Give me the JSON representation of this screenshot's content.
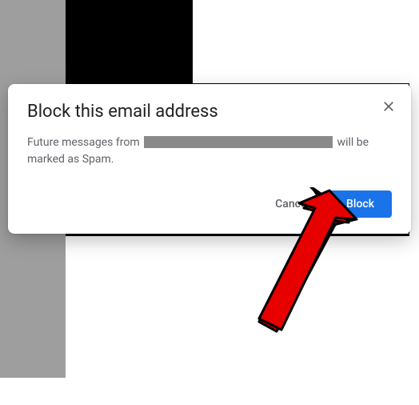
{
  "dialog": {
    "title": "Block this email address",
    "body_prefix": "Future messages from ",
    "body_suffix": " will be marked as Spam.",
    "cancel_label": "Cancel",
    "block_label": "Block"
  }
}
